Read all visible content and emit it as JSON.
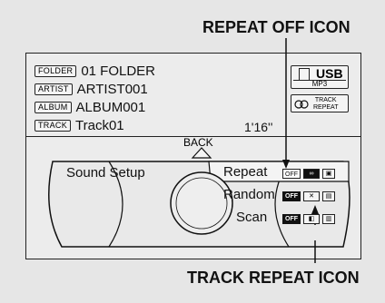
{
  "callouts": {
    "repeat_off_icon": "REPEAT OFF ICON",
    "track_repeat_icon": "TRACK REPEAT ICON"
  },
  "info": {
    "folder_tag": "FOLDER",
    "folder_value": "01 FOLDER",
    "artist_tag": "ARTIST",
    "artist_value": "ARTIST001",
    "album_tag": "ALBUM",
    "album_value": "ALBUM001",
    "track_tag": "TRACK",
    "track_value": "Track01",
    "time": "1'16''"
  },
  "source": {
    "usb_label": "USB",
    "format_label": "MP3",
    "track_repeat_line1": "TRACK",
    "track_repeat_line2": "REPEAT"
  },
  "navigation": {
    "back_label": "BACK"
  },
  "menu": {
    "sound_setup": "Sound Setup",
    "repeat": "Repeat",
    "random": "Random",
    "scan": "Scan"
  },
  "state_pills": {
    "off_label": "OFF"
  },
  "icons": {
    "usb": "usb-icon",
    "track_repeat": "track-repeat-icon",
    "repeat_off": "repeat-off-icon",
    "folder_repeat": "folder-repeat-icon",
    "random": "random-icon",
    "folder_random": "folder-random-icon",
    "scan": "scan-icon",
    "folder_scan": "folder-scan-icon"
  },
  "colors": {
    "background": "#e6e6e6",
    "screen": "#ececec",
    "ink": "#111111"
  }
}
